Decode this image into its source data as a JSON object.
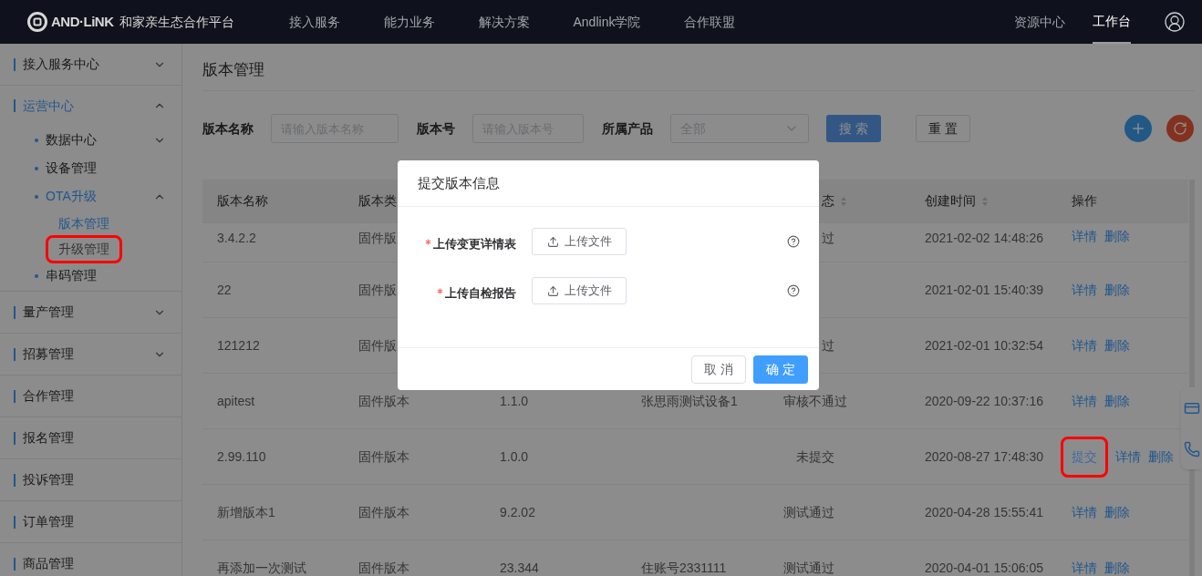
{
  "header": {
    "logo_text": "AND·LiNK",
    "brand": "和家亲生态合作平台",
    "nav": [
      {
        "label": "接入服务",
        "selected": false
      },
      {
        "label": "能力业务",
        "selected": false
      },
      {
        "label": "解决方案",
        "selected": false
      },
      {
        "label": "Andlink学院",
        "selected": false
      },
      {
        "label": "合作联盟",
        "selected": false
      }
    ],
    "right_nav": [
      {
        "label": "资源中心",
        "selected": false
      },
      {
        "label": "工作台",
        "selected": true
      }
    ]
  },
  "sidebar": {
    "items": [
      {
        "label": "接入服务中心",
        "kind": "group",
        "expanded": false,
        "selected": false
      },
      {
        "label": "运营中心",
        "kind": "group",
        "expanded": true,
        "selected": true,
        "children": [
          {
            "label": "数据中心",
            "kind": "group",
            "expanded": false,
            "selected": false
          },
          {
            "label": "设备管理",
            "kind": "link",
            "selected": false
          },
          {
            "label": "OTA升级",
            "kind": "group",
            "expanded": true,
            "selected": true,
            "children": [
              {
                "label": "版本管理",
                "selected": true,
                "annotated": false
              },
              {
                "label": "升级管理",
                "selected": false,
                "annotated": true
              }
            ]
          },
          {
            "label": "串码管理",
            "kind": "link",
            "selected": false
          }
        ]
      },
      {
        "label": "量产管理",
        "kind": "group",
        "expanded": false,
        "selected": false
      },
      {
        "label": "招募管理",
        "kind": "group",
        "expanded": false,
        "selected": false
      },
      {
        "label": "合作管理",
        "kind": "link",
        "selected": false
      },
      {
        "label": "报名管理",
        "kind": "link",
        "selected": false
      },
      {
        "label": "投诉管理",
        "kind": "link",
        "selected": false
      },
      {
        "label": "订单管理",
        "kind": "link",
        "selected": false
      },
      {
        "label": "商品管理",
        "kind": "link",
        "selected": false
      }
    ]
  },
  "page": {
    "title": "版本管理",
    "filters": [
      {
        "label": "版本名称",
        "kind": "input",
        "placeholder": "请输入版本名称"
      },
      {
        "label": "版本号",
        "kind": "input",
        "placeholder": "请输入版本号"
      },
      {
        "label": "所属产品",
        "kind": "select",
        "value": "全部"
      }
    ],
    "buttons": [
      {
        "label": "搜 索",
        "kind": "primary"
      },
      {
        "label": "重 置",
        "kind": "default"
      }
    ],
    "tool_buttons": [
      {
        "kind": "add"
      },
      {
        "kind": "refresh"
      }
    ],
    "table": {
      "columns": [
        {
          "label": "版本名称",
          "sortable": false
        },
        {
          "label": "版本类"
        },
        {
          "label": "态",
          "sortable": true
        },
        {
          "label": "创建时间",
          "sortable": true
        },
        {
          "label": "操作",
          "sortable": false
        }
      ],
      "rows": [
        {
          "name": "3.4.2.2",
          "type": "固件版",
          "status": "过",
          "created": "2021-02-02 14:48:26",
          "actions": [
            {
              "label": "详情",
              "annotated": false
            },
            {
              "label": "删除",
              "annotated": false
            }
          ]
        },
        {
          "name": "22",
          "type": "固件版",
          "created": "2021-02-01 15:40:39",
          "actions": [
            {
              "label": "详情",
              "annotated": false
            },
            {
              "label": "删除",
              "annotated": false
            }
          ]
        },
        {
          "name": "121212",
          "type": "固件版",
          "status": "过",
          "created": "2021-02-01 10:32:54",
          "actions": [
            {
              "label": "详情",
              "annotated": false
            },
            {
              "label": "删除",
              "annotated": false
            }
          ]
        },
        {
          "name": "apitest",
          "type": "固件版本",
          "version": "1.1.0",
          "product": "张思雨测试设备1",
          "status": "审核不通过",
          "created": "2020-09-22 10:37:16",
          "actions": [
            {
              "label": "详情",
              "annotated": false
            },
            {
              "label": "删除",
              "annotated": false
            }
          ]
        },
        {
          "name": "2.99.110",
          "type": "固件版本",
          "version": "1.0.0",
          "status": "未提交",
          "created": "2020-08-27 17:48:30",
          "actions": [
            {
              "label": "提交",
              "annotated": true
            },
            {
              "label": "详情",
              "annotated": false
            },
            {
              "label": "删除",
              "annotated": false
            }
          ]
        },
        {
          "name": "新增版本1",
          "type": "固件版本",
          "version": "9.2.02",
          "status": "测试通过",
          "created": "2020-04-28 15:55:41",
          "actions": [
            {
              "label": "详情",
              "annotated": false
            },
            {
              "label": "删除",
              "annotated": false
            }
          ]
        },
        {
          "name": "再添加一次测试",
          "type": "固件版本",
          "version": "23.344",
          "product": "住账号2331111",
          "status": "测试通过",
          "created": "2020-04-01 15:06:05",
          "actions": [
            {
              "label": "详情",
              "annotated": false
            },
            {
              "label": "删除",
              "annotated": false
            }
          ]
        }
      ]
    }
  },
  "side_widget": {
    "items": [
      {
        "kind": "card"
      },
      {
        "kind": "phone"
      }
    ]
  },
  "modal": {
    "title": "提交版本信息",
    "fields": [
      {
        "label": "上传变更详情表",
        "required": true,
        "button": "上传文件"
      },
      {
        "label": "上传自检报告",
        "required": true,
        "button": "上传文件"
      }
    ],
    "buttons": [
      {
        "label": "取 消",
        "kind": "default"
      },
      {
        "label": "确 定",
        "kind": "primary"
      }
    ]
  }
}
